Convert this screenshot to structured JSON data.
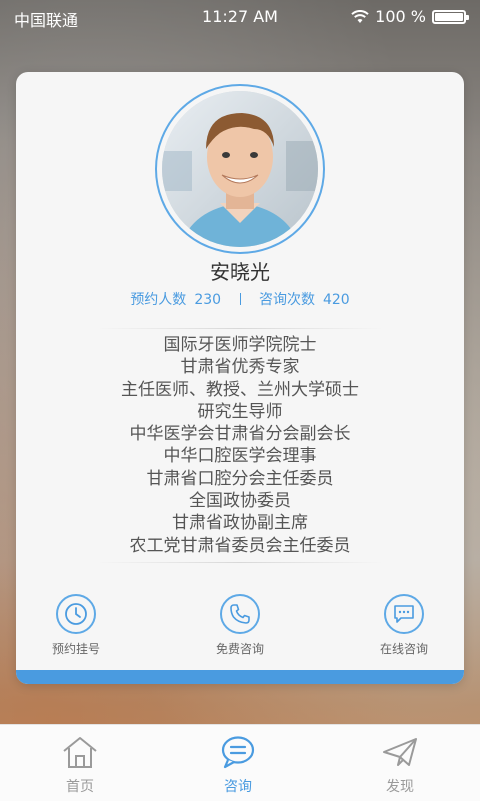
{
  "status_bar": {
    "carrier": "中国联通",
    "time": "11:27 AM",
    "battery_text": "100 %",
    "icons": [
      "wifi-icon",
      "battery-icon"
    ]
  },
  "profile": {
    "name": "安晓光",
    "appointments_label": "预约人数",
    "appointments_count": "230",
    "consults_label": "咨询次数",
    "consults_count": "420",
    "titles": [
      "国际牙医师学院院士",
      "甘肃省优秀专家",
      "主任医师、教授、兰州大学硕士",
      "研究生导师",
      "中华医学会甘肃省分会副会长",
      "中华口腔医学会理事",
      "甘肃省口腔分会主任委员",
      "全国政协委员",
      "甘肃省政协副主席",
      "农工党甘肃省委员会主任委员"
    ]
  },
  "actions": [
    {
      "label": "预约挂号",
      "icon": "clock-icon"
    },
    {
      "label": "免费咨询",
      "icon": "phone-icon"
    },
    {
      "label": "在线咨询",
      "icon": "chat-icon"
    }
  ],
  "tabs": [
    {
      "label": "首页",
      "icon": "home-icon",
      "active": false
    },
    {
      "label": "咨询",
      "icon": "message-icon",
      "active": true
    },
    {
      "label": "发现",
      "icon": "send-icon",
      "active": false
    }
  ],
  "colors": {
    "accent": "#4a9be0",
    "inactive": "#9a9a9a",
    "card": "#f6f6f6"
  }
}
